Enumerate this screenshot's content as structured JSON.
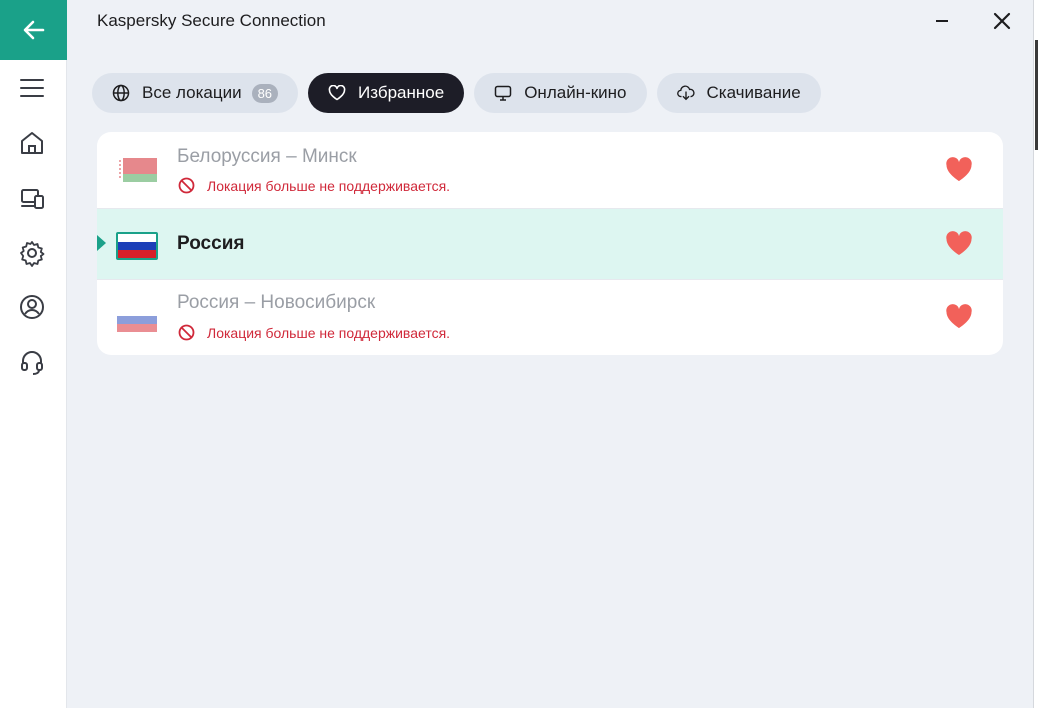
{
  "window": {
    "title": "Kaspersky Secure Connection"
  },
  "sidebar": {
    "items": [
      {
        "name": "menu"
      },
      {
        "name": "home"
      },
      {
        "name": "devices"
      },
      {
        "name": "settings"
      },
      {
        "name": "account"
      },
      {
        "name": "support"
      }
    ]
  },
  "tabs": [
    {
      "label": "Все локации",
      "badge": "86",
      "icon": "globe-icon",
      "active": false
    },
    {
      "label": "Избранное",
      "icon": "heart-outline-icon",
      "active": true
    },
    {
      "label": "Онлайн-кино",
      "icon": "screen-icon",
      "active": false
    },
    {
      "label": "Скачивание",
      "icon": "cloud-download-icon",
      "active": false
    }
  ],
  "locations": [
    {
      "name": "Белоруссия – Минск",
      "status": "Локация больше не поддерживается.",
      "available": false,
      "favorite": true
    },
    {
      "name": "Россия",
      "available": true,
      "selected": true,
      "favorite": true
    },
    {
      "name": "Россия – Новосибирск",
      "status": "Локация больше не поддерживается.",
      "available": false,
      "favorite": true
    }
  ],
  "colors": {
    "accent": "#1aa189",
    "heart": "#f2615a",
    "warning": "#d0293a",
    "selected_row": "#ddf6f1",
    "active_tab": "#1d1d27"
  }
}
